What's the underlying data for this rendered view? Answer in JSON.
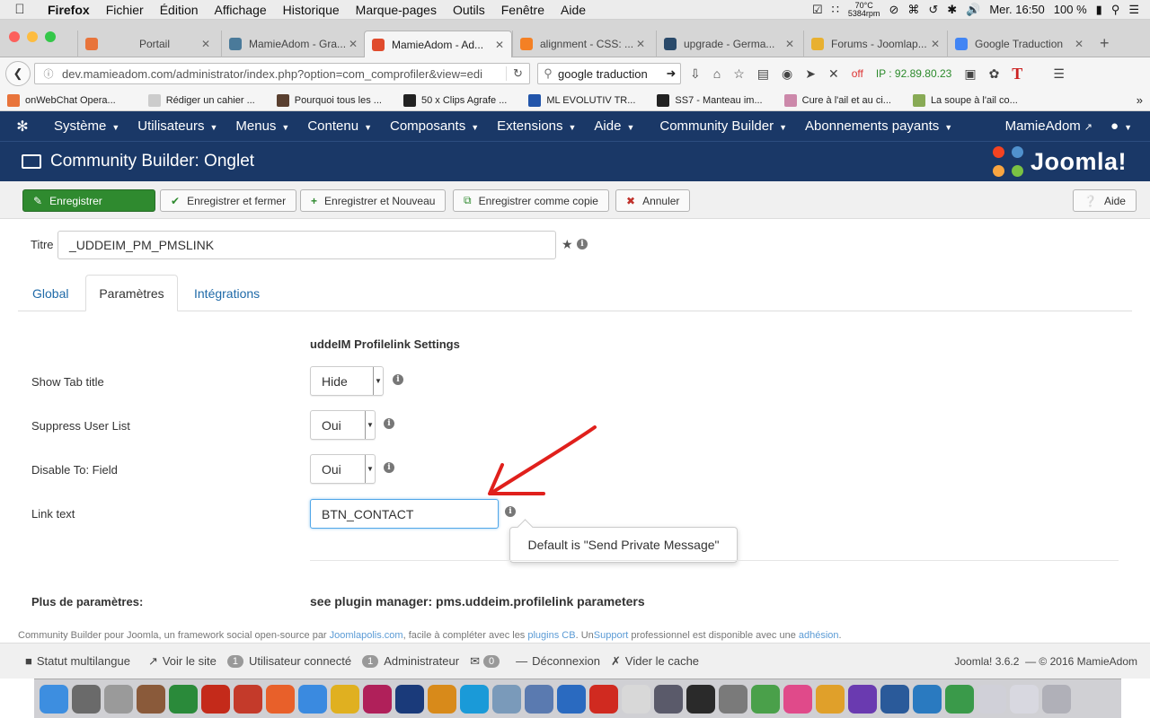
{
  "macos_menubar": {
    "app": "Firefox",
    "menus": [
      "Fichier",
      "Édition",
      "Affichage",
      "Historique",
      "Marque-pages",
      "Outils",
      "Fenêtre",
      "Aide"
    ],
    "temperature": "70°C",
    "fan": "5384rpm",
    "clock": "Mer. 16:50",
    "battery": "100 %"
  },
  "browser": {
    "tabs": [
      {
        "label": "Portail",
        "color": "#e8743b"
      },
      {
        "label": "MamieAdom - Gra...",
        "color": "#4a7a9a"
      },
      {
        "label": "MamieAdom - Ad...",
        "color": "#e04b2d"
      },
      {
        "label": "alignment - CSS: ...",
        "color": "#f48024"
      },
      {
        "label": "upgrade - Germa...",
        "color": "#2a4a6a"
      },
      {
        "label": "Forums - Joomlap...",
        "color": "#e8b030"
      },
      {
        "label": "Google Traduction",
        "color": "#4285f4"
      }
    ],
    "url": "dev.mamieadom.com/administrator/index.php?option=com_comprofiler&view=edi",
    "search_value": "google traduction",
    "ip_text": "IP : 92.89.80.23",
    "off_label": "off",
    "bookmarks": [
      {
        "label": "onWebChat Opera...",
        "color": "#e8743b"
      },
      {
        "label": "Rédiger un cahier ...",
        "color": "#cccccc"
      },
      {
        "label": "Pourquoi tous les ...",
        "color": "#5a4030"
      },
      {
        "label": "50 x Clips Agrafe ...",
        "color": "#222222"
      },
      {
        "label": "ML EVOLUTIV TR...",
        "color": "#2255aa"
      },
      {
        "label": "SS7 - Manteau im...",
        "color": "#222222"
      },
      {
        "label": "Cure à l'ail et au ci...",
        "color": "#cc88aa"
      },
      {
        "label": "La soupe à l'ail co...",
        "color": "#88aa55"
      }
    ]
  },
  "joomla": {
    "menu": [
      "Système",
      "Utilisateurs",
      "Menus",
      "Contenu",
      "Composants",
      "Extensions",
      "Aide",
      "Community Builder",
      "Abonnements payants"
    ],
    "user_link": "MamieAdom",
    "page_title": "Community Builder: Onglet",
    "brand": "Joomla!",
    "toolbar": {
      "save": "Enregistrer",
      "save_close": "Enregistrer et fermer",
      "save_new": "Enregistrer et Nouveau",
      "save_copy": "Enregistrer comme copie",
      "cancel": "Annuler",
      "help": "Aide"
    },
    "title_label": "Titre",
    "title_value": "_UDDEIM_PM_PMSLINK",
    "tabs": [
      "Global",
      "Paramètres",
      "Intégrations"
    ],
    "section_heading": "uddeIM Profilelink Settings",
    "fields": {
      "show_tab_title": {
        "label": "Show Tab title",
        "value": "Hide"
      },
      "suppress_user_list": {
        "label": "Suppress User List",
        "value": "Oui"
      },
      "disable_to_field": {
        "label": "Disable To: Field",
        "value": "Oui"
      },
      "link_text": {
        "label": "Link text",
        "value": "BTN_CONTACT"
      }
    },
    "tooltip": "Default is \"Send Private Message\"",
    "more_params_label": "Plus de paramètres:",
    "more_params_value": "see plugin manager: pms.uddeim.profilelink parameters",
    "footnote": {
      "t1": "Community Builder pour Joomla, un framework social open-source par ",
      "l1": "Joomlapolis.com",
      "t2": ", facile à compléter avec les ",
      "l2": "plugins CB",
      "t3": ". Un",
      "l3": "Support",
      "t4": " professionnel est disponible avec une ",
      "l4": "adhésion",
      "t5": "."
    },
    "status": {
      "multilang": "Statut multilangue",
      "view_site": "Voir le site",
      "users_count": "1",
      "users_label": "Utilisateur connecté",
      "admin_count": "1",
      "admin_label": "Administrateur",
      "msg_count": "0",
      "logout": "Déconnexion",
      "clear_cache": "Vider le cache",
      "version": "Joomla! 3.6.2",
      "copyright": "— © 2016 MamieAdom"
    }
  },
  "annotation": {
    "color": "#e0201c"
  },
  "dock": [
    {
      "name": "finder",
      "color": "#3d8ee0"
    },
    {
      "name": "app-2",
      "color": "#6a6a6a"
    },
    {
      "name": "help",
      "color": "#9a9a9a"
    },
    {
      "name": "app-4",
      "color": "#8a5a3a"
    },
    {
      "name": "app-5",
      "color": "#2a8a3a"
    },
    {
      "name": "filezilla",
      "color": "#c42a1a"
    },
    {
      "name": "app-7",
      "color": "#c43a2a"
    },
    {
      "name": "firefox",
      "color": "#e8602a"
    },
    {
      "name": "safari",
      "color": "#3a8ae0"
    },
    {
      "name": "chrome",
      "color": "#e0b020"
    },
    {
      "name": "indesign",
      "color": "#b0205a"
    },
    {
      "name": "photoshop",
      "color": "#1a3a7a"
    },
    {
      "name": "illustrator",
      "color": "#d88a1a"
    },
    {
      "name": "skype",
      "color": "#1a9ad8"
    },
    {
      "name": "app-15",
      "color": "#7a9aba"
    },
    {
      "name": "app-16",
      "color": "#5a7ab0"
    },
    {
      "name": "app-17",
      "color": "#2a6ac0"
    },
    {
      "name": "acrobat",
      "color": "#d02a20"
    },
    {
      "name": "app-19",
      "color": "#d8d8d8"
    },
    {
      "name": "app-20",
      "color": "#5a5a6a"
    },
    {
      "name": "app-21",
      "color": "#2a2a2a"
    },
    {
      "name": "app-22",
      "color": "#7a7a7a"
    },
    {
      "name": "app-23",
      "color": "#4aa04a"
    },
    {
      "name": "itunes",
      "color": "#e04a8a"
    },
    {
      "name": "photos",
      "color": "#e0a02a"
    },
    {
      "name": "app-26",
      "color": "#6a3ab0"
    },
    {
      "name": "app-27",
      "color": "#2a5a9a"
    },
    {
      "name": "app-28",
      "color": "#2a7ac0"
    },
    {
      "name": "app-29",
      "color": "#3a9a4a"
    },
    {
      "name": "app-30",
      "color": "#d0d0d8"
    },
    {
      "name": "app-31",
      "color": "#d8d8e0"
    },
    {
      "name": "trash",
      "color": "#b0b0b8"
    }
  ]
}
